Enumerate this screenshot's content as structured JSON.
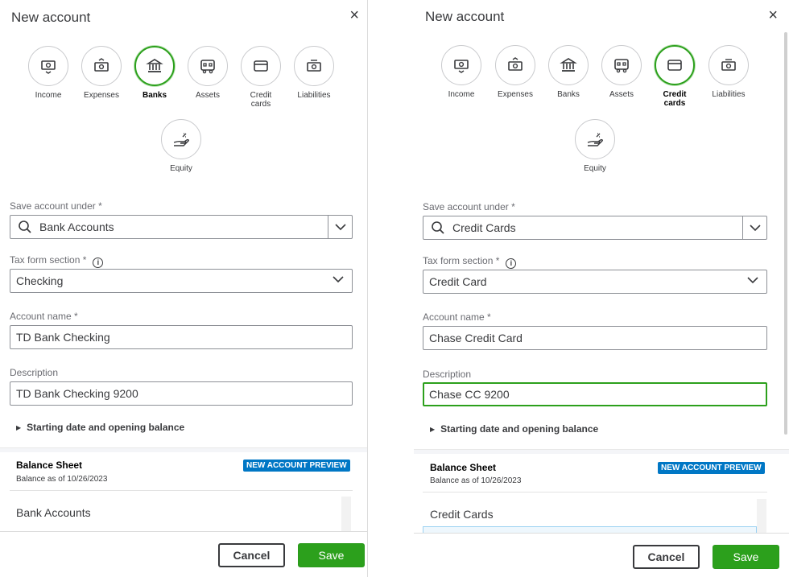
{
  "left": {
    "header": "New account",
    "account_types": [
      {
        "label": "Income",
        "icon": "income-icon"
      },
      {
        "label": "Expenses",
        "icon": "expenses-icon"
      },
      {
        "label": "Banks",
        "icon": "bank-icon"
      },
      {
        "label": "Assets",
        "icon": "assets-icon"
      },
      {
        "label": "Credit cards",
        "icon": "credit-card-icon"
      },
      {
        "label": "Liabilities",
        "icon": "liabilities-icon"
      },
      {
        "label": "Equity",
        "icon": "equity-icon"
      }
    ],
    "selected_type": "Banks",
    "save_under_label": "Save account under *",
    "save_under_value": "Bank Accounts",
    "tax_label": "Tax form section *",
    "tax_value": "Checking",
    "name_label": "Account name *",
    "name_value": "TD Bank Checking",
    "desc_label": "Description",
    "desc_value": "TD Bank Checking 9200",
    "expander": "Starting date and opening balance",
    "bs_title": "Balance Sheet",
    "bs_sub": "Balance as of 10/26/2023",
    "badge": "NEW ACCOUNT PREVIEW",
    "bs_row": "Bank Accounts",
    "cancel": "Cancel",
    "save": "Save"
  },
  "right": {
    "header": "New account",
    "account_types": [
      {
        "label": "Income",
        "icon": "income-icon"
      },
      {
        "label": "Expenses",
        "icon": "expenses-icon"
      },
      {
        "label": "Banks",
        "icon": "bank-icon"
      },
      {
        "label": "Assets",
        "icon": "assets-icon"
      },
      {
        "label": "Credit cards",
        "icon": "credit-card-icon"
      },
      {
        "label": "Liabilities",
        "icon": "liabilities-icon"
      },
      {
        "label": "Equity",
        "icon": "equity-icon"
      }
    ],
    "selected_type": "Credit cards",
    "save_under_label": "Save account under *",
    "save_under_value": "Credit Cards",
    "tax_label": "Tax form section *",
    "tax_value": "Credit Card",
    "name_label": "Account name *",
    "name_value": "Chase Credit Card",
    "desc_label": "Description",
    "desc_value": "Chase CC 9200",
    "expander": "Starting date and opening balance",
    "bs_title": "Balance Sheet",
    "bs_sub": "Balance as of 10/26/2023",
    "badge": "NEW ACCOUNT PREVIEW",
    "bs_row": "Credit Cards",
    "cancel": "Cancel",
    "save": "Save"
  },
  "icons": {
    "close": "×",
    "info": "i",
    "expander": "▶"
  },
  "colors": {
    "accent_green": "#2ca01c",
    "badge_blue": "#0077c5",
    "text": "#393a3d"
  }
}
